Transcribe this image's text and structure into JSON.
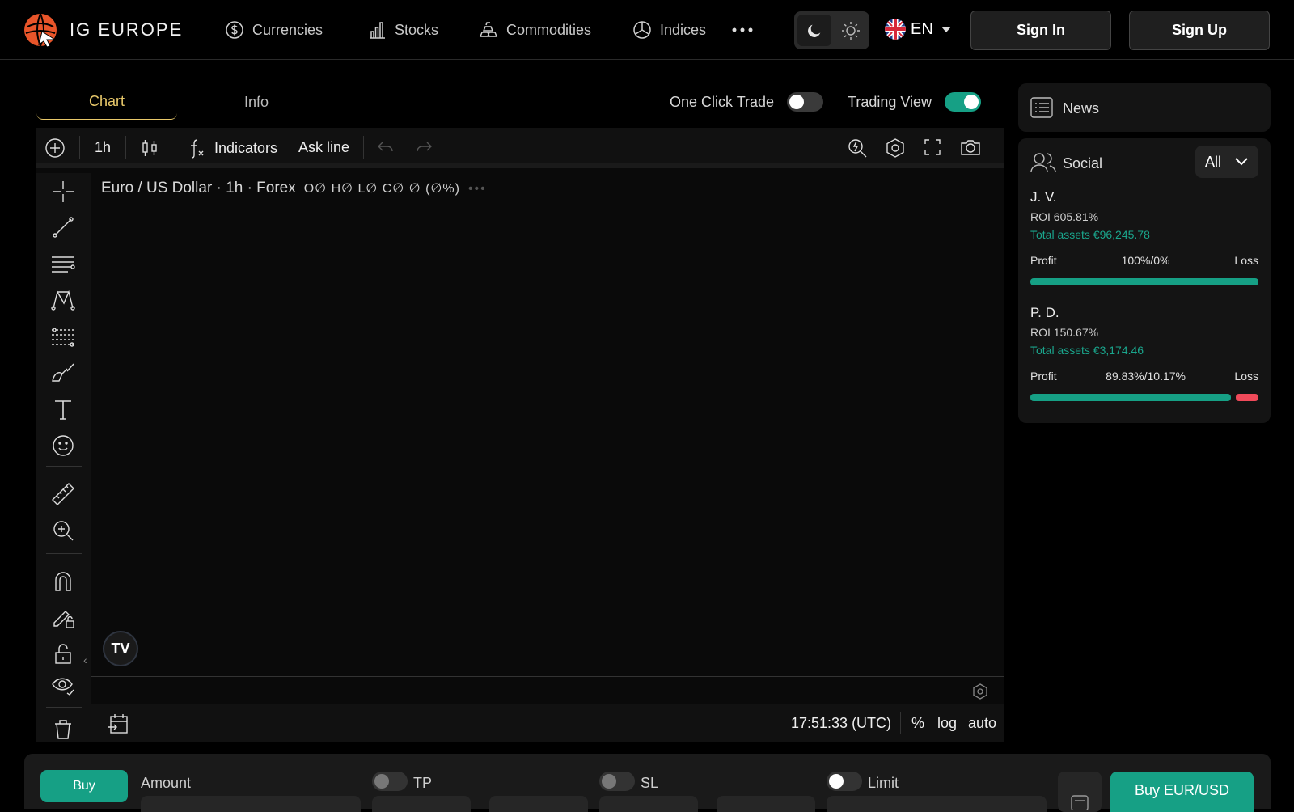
{
  "brand": {
    "name": "IG EUROPE"
  },
  "nav": {
    "items": [
      {
        "label": "Currencies",
        "icon": "dollar-coin-icon"
      },
      {
        "label": "Stocks",
        "icon": "bar-chart-icon"
      },
      {
        "label": "Commodities",
        "icon": "gold-bars-icon"
      },
      {
        "label": "Indices",
        "icon": "pie-chart-icon"
      }
    ],
    "more_icon": "more-dots-icon",
    "language": "EN",
    "sign_in": "Sign In",
    "sign_up": "Sign Up"
  },
  "tabs": {
    "chart": "Chart",
    "info": "Info"
  },
  "toggles": {
    "one_click_trade": {
      "label": "One Click Trade",
      "on": false
    },
    "trading_view": {
      "label": "Trading View",
      "on": true
    }
  },
  "chart": {
    "interval": "1h",
    "indicators_label": "Indicators",
    "ask_line_label": "Ask line",
    "title": "Euro / US Dollar · 1h · Forex",
    "ohlc": "O∅ H∅ L∅ C∅ ∅ (∅%)",
    "logo": "TV",
    "time": "17:51:33 (UTC)",
    "scale_percent": "%",
    "scale_log": "log",
    "scale_auto": "auto"
  },
  "news": {
    "title": "News"
  },
  "social": {
    "title": "Social",
    "filter": "All",
    "traders": [
      {
        "name": "J. V.",
        "roi": "ROI 605.81%",
        "assets": "Total assets €96,245.78",
        "profit_label": "Profit",
        "ratio": "100%/0%",
        "loss_label": "Loss",
        "profit_fraction": 1.0
      },
      {
        "name": "P. D.",
        "roi": "ROI 150.67%",
        "assets": "Total assets €3,174.46",
        "profit_label": "Profit",
        "ratio": "89.83%/10.17%",
        "loss_label": "Loss",
        "profit_fraction": 0.8983
      }
    ]
  },
  "order": {
    "side": "Buy",
    "amount_label": "Amount",
    "tp_label": "TP",
    "sl_label": "SL",
    "limit_label": "Limit",
    "submit": "Buy EUR/USD"
  },
  "colors": {
    "accent": "#16a085",
    "gold": "#e8c86a",
    "loss": "#f04a5a",
    "brand_orange": "#e8552a"
  }
}
